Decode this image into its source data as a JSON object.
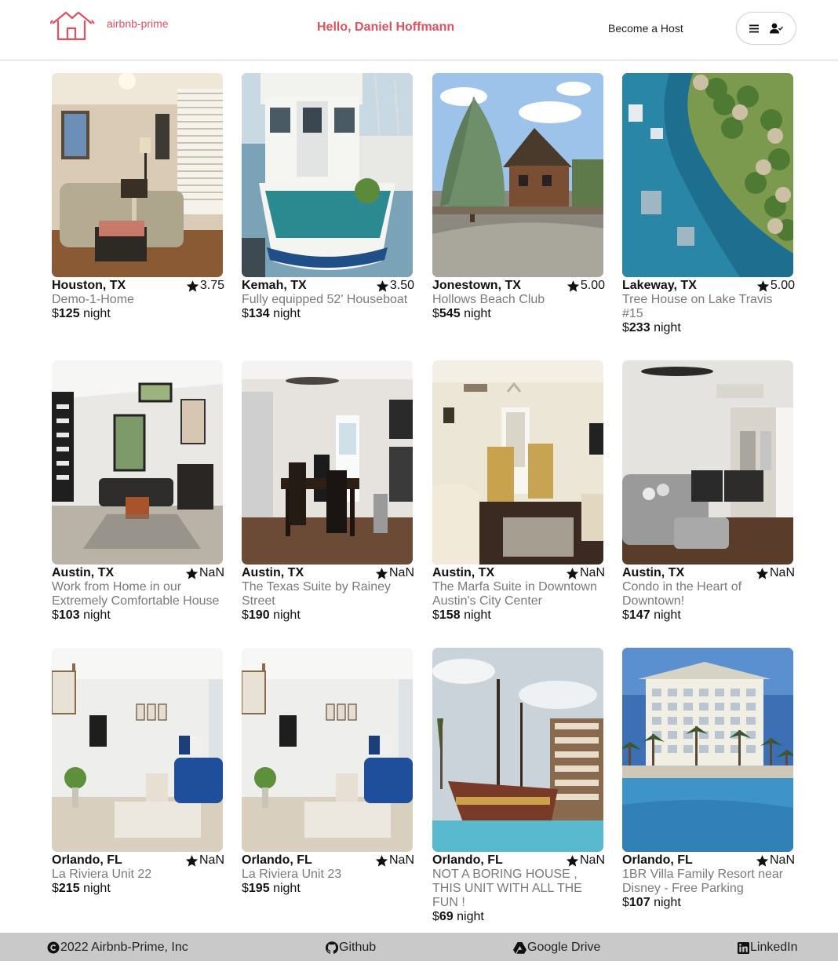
{
  "header": {
    "logo_text": "airbnb-prime",
    "greeting": "Hello, Daniel Hoffmann",
    "become_host": "Become a Host"
  },
  "listings": [
    {
      "location": "Houston, TX",
      "rating": "3.75",
      "title": "Demo-1-Home",
      "currency": "$",
      "price": "125",
      "unit": "night",
      "scene": "living-room"
    },
    {
      "location": "Kemah, TX",
      "rating": "3.50",
      "title": "Fully equipped 52' Houseboat",
      "currency": "$",
      "price": "134",
      "unit": "night",
      "scene": "houseboat"
    },
    {
      "location": "Jonestown, TX",
      "rating": "5.00",
      "title": "Hollows Beach Club",
      "currency": "$",
      "price": "545",
      "unit": "night",
      "scene": "cabin"
    },
    {
      "location": "Lakeway, TX",
      "rating": "5.00",
      "title": "Tree House on Lake Travis #15",
      "currency": "$",
      "price": "233",
      "unit": "night",
      "scene": "lake-aerial"
    },
    {
      "location": "Austin, TX",
      "rating": "NaN",
      "title": "Work from Home in our Extremely Comfortable House",
      "currency": "$",
      "price": "103",
      "unit": "night",
      "scene": "modern-living"
    },
    {
      "location": "Austin, TX",
      "rating": "NaN",
      "title": "The Texas Suite by Rainey Street",
      "currency": "$",
      "price": "190",
      "unit": "night",
      "scene": "dining"
    },
    {
      "location": "Austin, TX",
      "rating": "NaN",
      "title": "The Marfa Suite in Downtown Austin's City Center",
      "currency": "$",
      "price": "158",
      "unit": "night",
      "scene": "suite"
    },
    {
      "location": "Austin, TX",
      "rating": "NaN",
      "title": "Condo in the Heart of Downtown!",
      "currency": "$",
      "price": "147",
      "unit": "night",
      "scene": "condo"
    },
    {
      "location": "Orlando, FL",
      "rating": "NaN",
      "title": "La Riviera Unit 22",
      "currency": "$",
      "price": "215",
      "unit": "night",
      "scene": "white-living"
    },
    {
      "location": "Orlando, FL",
      "rating": "NaN",
      "title": "La Riviera Unit 23",
      "currency": "$",
      "price": "195",
      "unit": "night",
      "scene": "white-living"
    },
    {
      "location": "Orlando, FL",
      "rating": "NaN",
      "title": "NOT A BORING HOUSE , THIS UNIT WITH ALL THE FUN !",
      "currency": "$",
      "price": "69",
      "unit": "night",
      "scene": "pirate-pool"
    },
    {
      "location": "Orlando, FL",
      "rating": "NaN",
      "title": "1BR Villa Family Resort near Disney - Free Parking",
      "currency": "$",
      "price": "107",
      "unit": "night",
      "scene": "resort"
    }
  ],
  "footer": {
    "copyright": "2022 Airbnb-Prime, Inc",
    "github": "Github",
    "drive": "Google Drive",
    "linkedin": "LinkedIn"
  },
  "colors": {
    "brand": "#e0505f",
    "footer_bg": "#c9c9c9"
  }
}
